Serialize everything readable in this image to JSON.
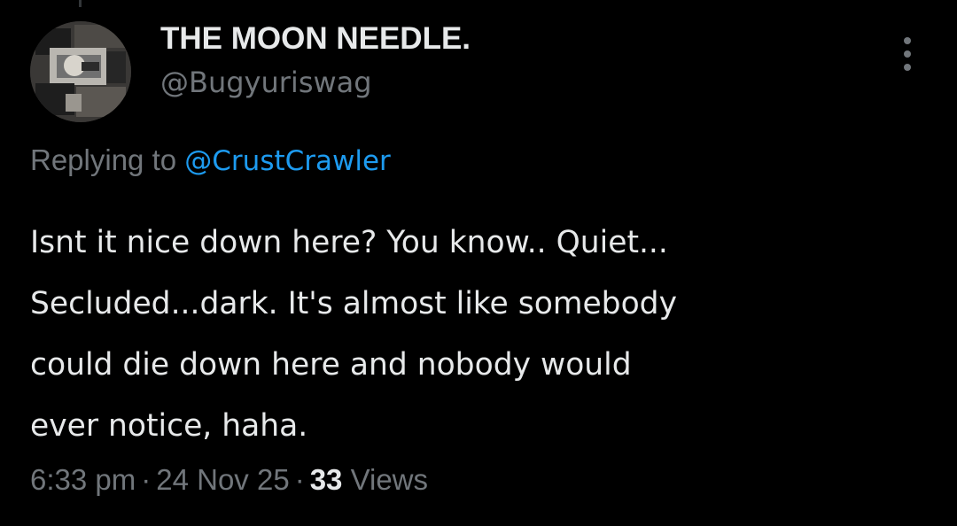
{
  "tweet": {
    "display_name": "THE MOON NEEDLE.",
    "handle": "@Bugyuriswag",
    "more_icon": "more-dots-vertical-icon",
    "replying_prefix": "Replying to",
    "replying_to": "@CrustCrawler",
    "text_lines": [
      "Isnt it nice down here? You know.. Quiet...",
      "Secluded...dark. It's almost like somebody",
      "could die down here and nobody would",
      "ever notice, haha."
    ],
    "time": "6:33 pm",
    "separator": "·",
    "date": "24 Nov 25",
    "views_count": "33",
    "views_label": "Views"
  },
  "colors": {
    "background": "#000000",
    "primary_text": "#e7e9ea",
    "secondary_text": "#71767b",
    "link": "#1d9bf0"
  }
}
